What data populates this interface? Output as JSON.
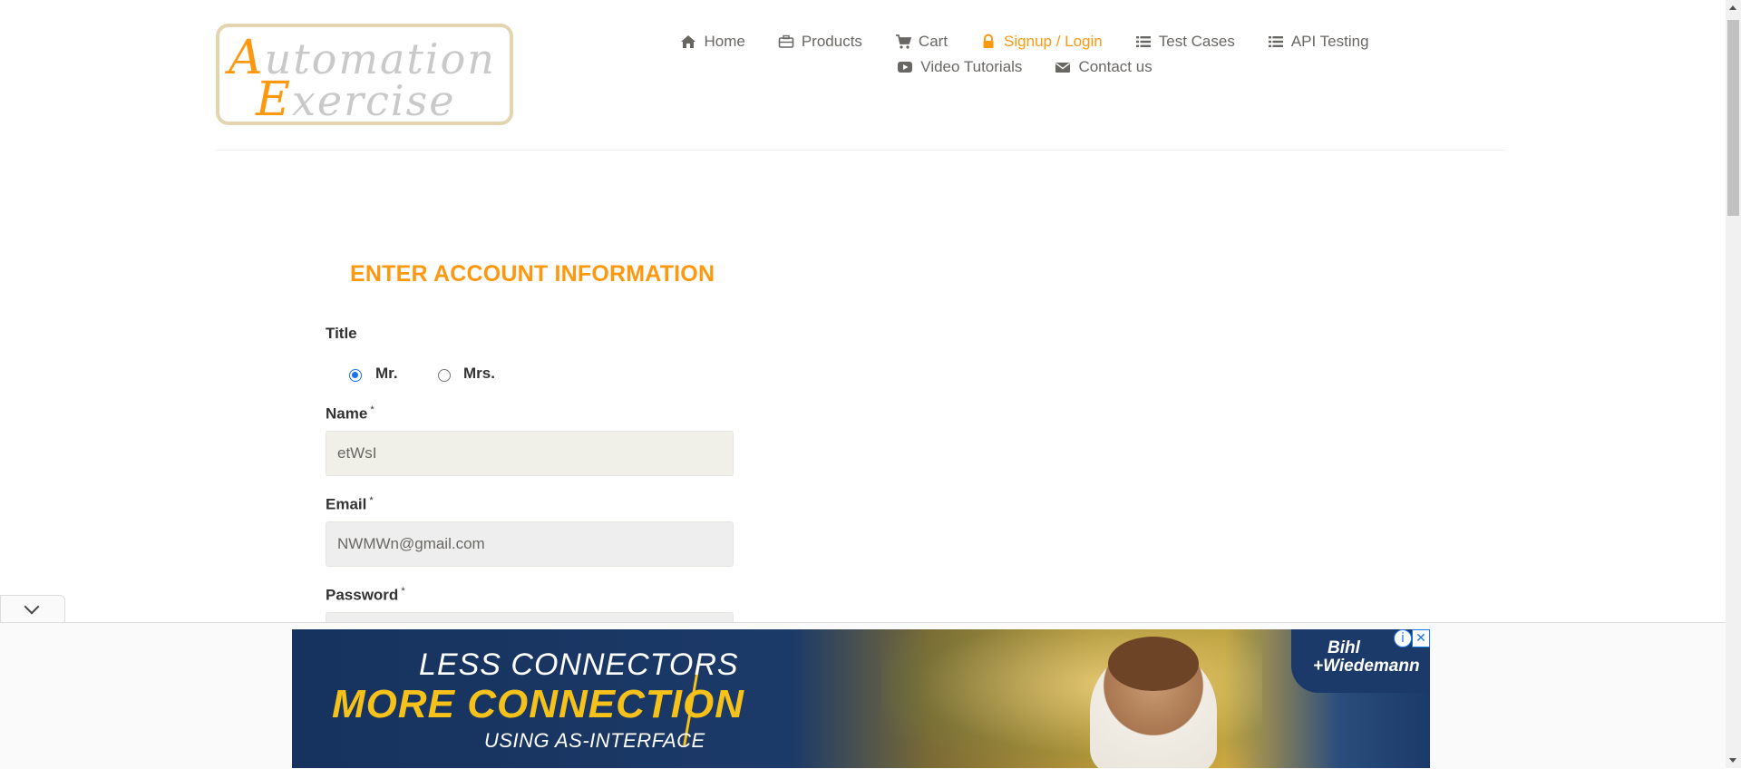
{
  "logo": {
    "line1_cap": "A",
    "line1_rest": "utomation",
    "line2_cap": "E",
    "line2_rest": "xercise"
  },
  "nav": {
    "row1": [
      {
        "icon": "home-icon",
        "label": "Home"
      },
      {
        "icon": "briefcase-icon",
        "label": "Products"
      },
      {
        "icon": "cart-icon",
        "label": "Cart"
      },
      {
        "icon": "lock-icon",
        "label": "Signup / Login",
        "active": true
      },
      {
        "icon": "list-icon",
        "label": "Test Cases"
      },
      {
        "icon": "list-icon",
        "label": "API Testing"
      }
    ],
    "row2": [
      {
        "icon": "youtube-icon",
        "label": "Video Tutorials"
      },
      {
        "icon": "envelope-icon",
        "label": "Contact us"
      }
    ]
  },
  "form": {
    "heading": "ENTER ACCOUNT INFORMATION",
    "title_label": "Title",
    "title_options": [
      "Mr.",
      "Mrs."
    ],
    "title_selected": "Mr.",
    "name_label": "Name",
    "name_value": "etWsI",
    "email_label": "Email",
    "email_value": "NWMWn@gmail.com",
    "password_label": "Password",
    "required_mark": "*"
  },
  "ad": {
    "line1": "LESS CONNECTORS",
    "line2": "MORE CONNECTION",
    "line3": "USING AS-INTERFACE",
    "brand_line1": "Bihl",
    "brand_line2": "+Wiedemann",
    "info_glyph": "i",
    "close_glyph": "✕"
  },
  "colors": {
    "accent": "#fe980f",
    "text": "#696763",
    "radio_checked": "#1a73e8",
    "ad_navy": "#16325e",
    "ad_yellow": "#f6c21a"
  }
}
